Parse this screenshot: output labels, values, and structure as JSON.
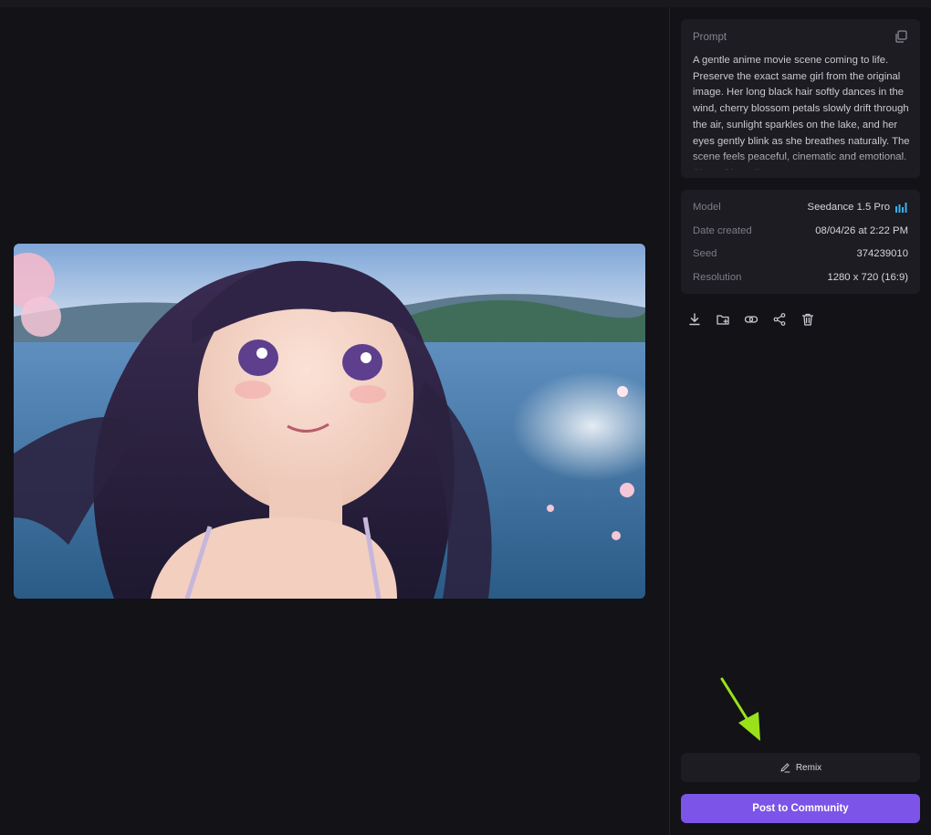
{
  "prompt": {
    "label": "Prompt",
    "text": "A gentle anime movie scene coming to life. Preserve the exact same girl from the original image. Her long black hair softly dances in the wind, cherry blossom petals slowly drift through the air, sunlight sparkles on the lake, and her eyes gently blink as she breathes naturally. The scene feels peaceful, cinematic and emotional. She softly smiles"
  },
  "details": {
    "model": {
      "label": "Model",
      "value": "Seedance 1.5 Pro"
    },
    "date": {
      "label": "Date created",
      "value": "08/04/26 at 2:22 PM"
    },
    "seed": {
      "label": "Seed",
      "value": "374239010"
    },
    "resolution": {
      "label": "Resolution",
      "value": "1280 x 720 (16:9)"
    }
  },
  "actions": [
    "download-icon",
    "add-to-folder-icon",
    "link-icon",
    "share-icon",
    "trash-icon"
  ],
  "buttons": {
    "remix": "Remix",
    "post": "Post to Community"
  },
  "colors": {
    "background": "#121217",
    "card": "#1c1c22",
    "accent": "#7c54e8",
    "annotation": "#9be11a",
    "model_badge": "#3ab0f0"
  }
}
